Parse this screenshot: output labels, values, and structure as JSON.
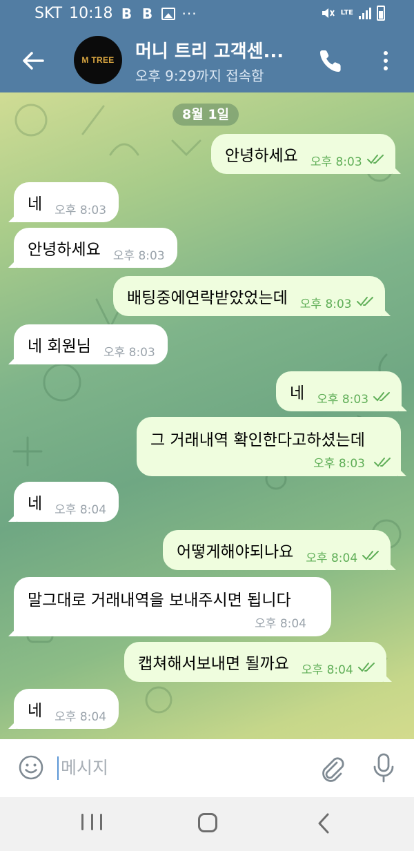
{
  "status_bar": {
    "carrier": "SKT",
    "time": "10:18",
    "badge_1": "B",
    "badge_2": "B",
    "more": "···",
    "network": "LTE",
    "icons": [
      "image-icon",
      "mute-icon",
      "signal-icon",
      "battery-icon"
    ]
  },
  "header": {
    "avatar_text": "M TREE",
    "title": "머니 트리 고객센...",
    "subtitle": "오후 9:29까지 접속함",
    "icons": [
      "back-arrow-icon",
      "phone-icon",
      "more-vertical-icon"
    ]
  },
  "chat": {
    "date_label": "8월 1일",
    "messages": [
      {
        "dir": "out",
        "text": "안녕하세요",
        "time": "오후 8:03",
        "read": true
      },
      {
        "dir": "in",
        "text": "네",
        "time": "오후 8:03"
      },
      {
        "dir": "in",
        "text": "안녕하세요",
        "time": "오후 8:03"
      },
      {
        "dir": "out",
        "text": "배팅중에연락받았었는데",
        "time": "오후 8:03",
        "read": true
      },
      {
        "dir": "in",
        "text": "네 회원님",
        "time": "오후 8:03"
      },
      {
        "dir": "out",
        "text": "네",
        "time": "오후 8:03",
        "read": true
      },
      {
        "dir": "out",
        "text": "그 거래내역 확인한다고하셨는데",
        "time": "오후 8:03",
        "read": true
      },
      {
        "dir": "in",
        "text": "네",
        "time": "오후 8:04"
      },
      {
        "dir": "out",
        "text": "어떻게해야되나요",
        "time": "오후 8:04",
        "read": true
      },
      {
        "dir": "in",
        "text": "말그대로 거래내역을 보내주시면 됩니다",
        "time": "오후 8:04"
      },
      {
        "dir": "out",
        "text": "캡쳐해서보내면 될까요",
        "time": "오후 8:04",
        "read": true
      },
      {
        "dir": "in",
        "text": "네",
        "time": "오후 8:04"
      }
    ]
  },
  "input": {
    "placeholder": "메시지",
    "value": "",
    "icons": [
      "emoji-icon",
      "attach-icon",
      "mic-icon"
    ]
  },
  "colors": {
    "header_blue": "#527da3",
    "outgoing_bubble": "#effdde",
    "incoming_bubble": "#ffffff",
    "time_green": "#5fae57"
  }
}
